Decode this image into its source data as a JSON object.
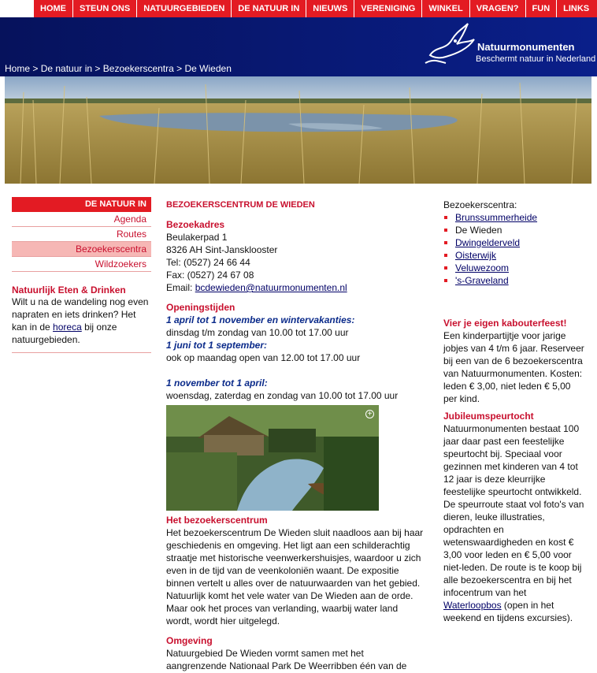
{
  "nav": [
    "HOME",
    "STEUN ONS",
    "NATUURGEBIEDEN",
    "DE NATUUR IN",
    "NIEUWS",
    "VERENIGING",
    "WINKEL",
    "VRAGEN?",
    "FUN",
    "LINKS"
  ],
  "logo": {
    "brand": "Natuurmonumenten",
    "slogan": "Beschermt natuur in Nederland"
  },
  "breadcrumb": {
    "items": [
      "Home",
      "De natuur in",
      "Bezoekerscentra",
      "De Wieden"
    ],
    "sep": " > "
  },
  "left": {
    "menu_head": "DE NATUUR IN",
    "menu": [
      "Agenda",
      "Routes",
      "Bezoekerscentra",
      "Wildzoekers"
    ],
    "active_index": 2,
    "section_title": "Natuurlijk Eten & Drinken",
    "section_text_before": "Wilt u na de wandeling nog even napraten en iets drinken? Het kan in de ",
    "section_link": "horeca",
    "section_text_after": " bij onze natuurgebieden."
  },
  "main": {
    "title": "BEZOEKERSCENTRUM DE WIEDEN",
    "address_title": "Bezoekadres",
    "address_lines": [
      "Beulakerpad 1",
      "8326 AH Sint-Jansklooster",
      "Tel: (0527) 24 66 44",
      "Fax: (0527) 24 67 08"
    ],
    "email_label": "Email: ",
    "email": "bcdewieden@natuurmonumenten.nl",
    "hours_title": "Openingstijden",
    "period1": "1 april tot 1 november en wintervakanties:",
    "hours1": "dinsdag t/m zondag van 10.00 tot 17.00 uur",
    "period2": "1 juni tot 1 september:",
    "hours2": "ook op maandag open van 12.00 tot 17.00 uur",
    "period3": "1 november tot 1 april:",
    "hours3": "woensdag, zaterdag en zondag van 10.00 tot 17.00 uur",
    "photo_zoom": "+",
    "center_title": "Het bezoekerscentrum",
    "center_text": "Het bezoekerscentrum De Wieden sluit naadloos aan bij haar geschiedenis en omgeving. Het ligt aan een schilderachtig straatje met historische veenwerkershuisjes, waardoor u zich even in de tijd van de veenkoloniën waant. De expositie binnen vertelt u alles over de natuurwaarden van het gebied. Natuurlijk komt het vele water van De Wieden aan de orde. Maar ook het proces van verlanding, waarbij water land wordt, wordt hier uitgelegd.",
    "env_title": "Omgeving",
    "env_text": "Natuurgebied De Wieden vormt samen met het aangrenzende Nationaal Park De Weerribben één van de"
  },
  "right": {
    "list_title": "Bezoekerscentra:",
    "centers": [
      "Brunssummerheide",
      "De Wieden",
      "Dwingelderveld",
      "Oisterwijk",
      "Veluwezoom",
      "'s-Graveland"
    ],
    "current_index": 1,
    "party_title": "Vier je eigen kabouterfeest!",
    "party_text": "Een kinderpartijtje voor jarige jobjes van 4 t/m 6 jaar. Reserveer bij een van de 6 bezoekerscentra van Natuurmonumenten. Kosten: leden € 3,00, niet leden € 5,00 per kind.",
    "jubilee_title": "Jubileumspeurtocht",
    "jubilee_text": "Natuurmonumenten bestaat 100 jaar daar past een feestelijke speurtocht bij. Speciaal voor gezinnen met kinderen van 4 tot 12 jaar is deze kleurrijke feestelijke speurtocht ontwikkeld. De speurroute staat vol foto's van dieren, leuke illustraties, opdrachten en wetenswaardigheden en kost € 3,00 voor leden en € 5,00 voor niet-leden. De route is te koop bij alle bezoekerscentra en bij het infocentrum van het ",
    "jubilee_link": "Waterloopbos",
    "jubilee_after": " (open in het weekend en tijdens excursies)."
  },
  "colors": {
    "red": "#e31b23",
    "navy": "#0a1f8a",
    "link": "#000066",
    "active": "#f6b7b5"
  },
  "icons": [
    "bird-logo-icon",
    "zoom-icon"
  ]
}
